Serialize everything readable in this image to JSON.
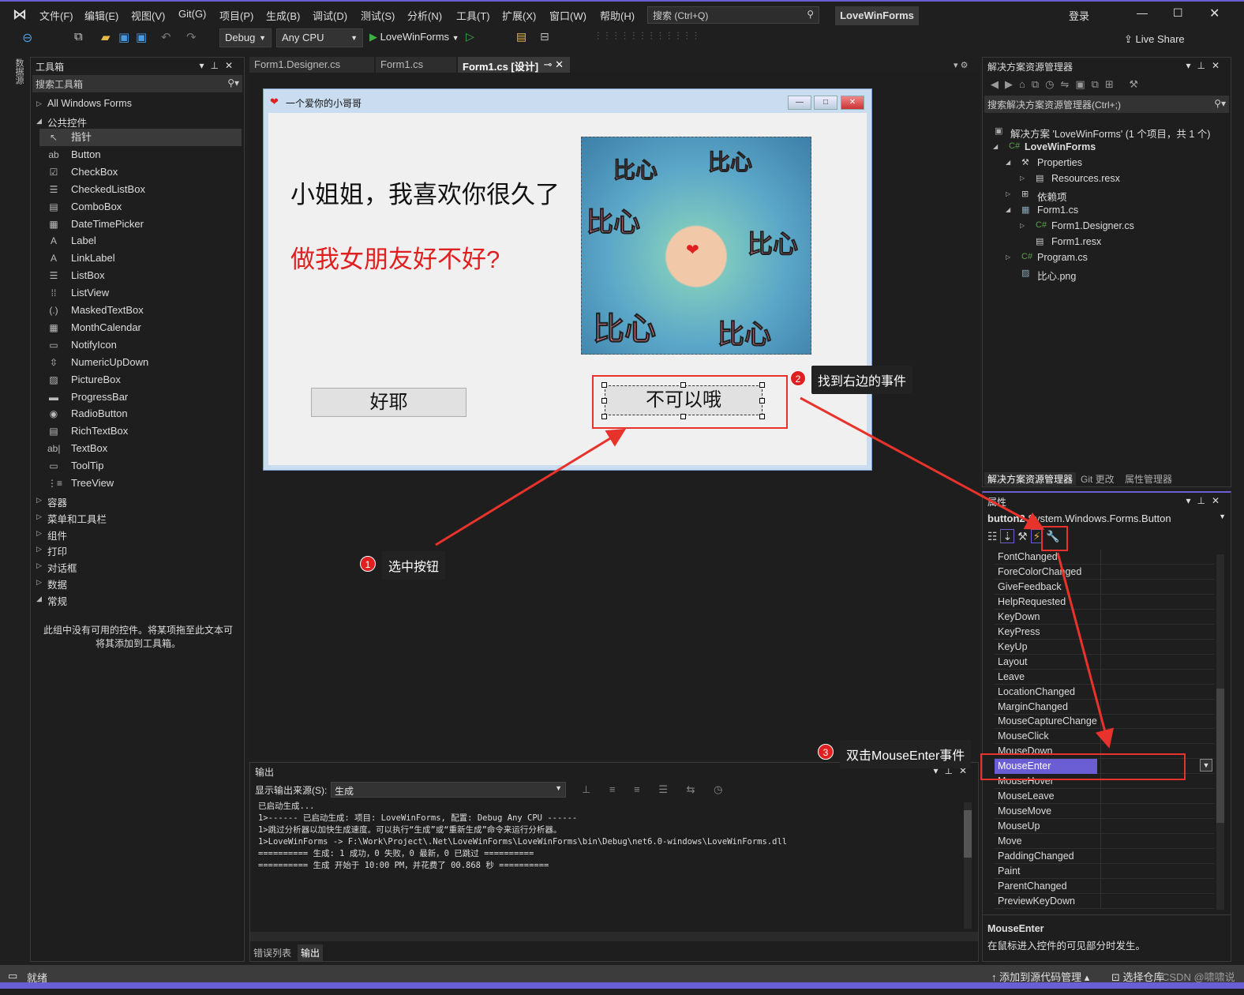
{
  "menu": [
    "文件(F)",
    "编辑(E)",
    "视图(V)",
    "Git(G)",
    "项目(P)",
    "生成(B)",
    "调试(D)",
    "测试(S)",
    "分析(N)",
    "工具(T)",
    "扩展(X)",
    "窗口(W)",
    "帮助(H)"
  ],
  "search_placeholder": "搜索 (Ctrl+Q)",
  "project_name": "LoveWinForms",
  "login": "登录",
  "live_share": "Live Share",
  "toolbar": {
    "config": "Debug",
    "platform": "Any CPU",
    "run_target": "LoveWinForms"
  },
  "side_strip": "数据源",
  "toolbox": {
    "title": "工具箱",
    "search_placeholder": "搜索工具箱",
    "all_forms": "All Windows Forms",
    "common": "公共控件",
    "items": [
      {
        "icon": "pointer",
        "label": "指针"
      },
      {
        "icon": "button",
        "label": "Button"
      },
      {
        "icon": "checkbox",
        "label": "CheckBox"
      },
      {
        "icon": "list",
        "label": "CheckedListBox"
      },
      {
        "icon": "combo",
        "label": "ComboBox"
      },
      {
        "icon": "calendar",
        "label": "DateTimePicker"
      },
      {
        "icon": "label",
        "label": "Label"
      },
      {
        "icon": "label",
        "label": "LinkLabel"
      },
      {
        "icon": "list",
        "label": "ListBox"
      },
      {
        "icon": "grid",
        "label": "ListView"
      },
      {
        "icon": "masked",
        "label": "MaskedTextBox"
      },
      {
        "icon": "calendar",
        "label": "MonthCalendar"
      },
      {
        "icon": "notify",
        "label": "NotifyIcon"
      },
      {
        "icon": "updown",
        "label": "NumericUpDown"
      },
      {
        "icon": "picture",
        "label": "PictureBox"
      },
      {
        "icon": "progress",
        "label": "ProgressBar"
      },
      {
        "icon": "radio",
        "label": "RadioButton"
      },
      {
        "icon": "richtext",
        "label": "RichTextBox"
      },
      {
        "icon": "textbox",
        "label": "TextBox"
      },
      {
        "icon": "tooltip",
        "label": "ToolTip"
      },
      {
        "icon": "tree",
        "label": "TreeView"
      }
    ],
    "categories": [
      "容器",
      "菜单和工具栏",
      "组件",
      "打印",
      "对话框",
      "数据",
      "常规"
    ],
    "empty_text": "此组中没有可用的控件。将某项拖至此文本可将其添加到工具箱。"
  },
  "tabs": [
    {
      "label": "Form1.Designer.cs"
    },
    {
      "label": "Form1.cs"
    },
    {
      "label": "Form1.cs [设计]",
      "active": true
    }
  ],
  "form": {
    "title": "一个爱你的小哥哥",
    "line1": "小姐姐，我喜欢你很久了",
    "line2": "做我女朋友好不好?",
    "picture_text": "比心",
    "button_yes": "好耶",
    "button_no": "不可以哦"
  },
  "annotations": [
    {
      "num": "1",
      "text": "选中按钮"
    },
    {
      "num": "2",
      "text": "找到右边的事件"
    },
    {
      "num": "3",
      "text": "双击MouseEnter事件"
    }
  ],
  "output": {
    "title": "输出",
    "source_label": "显示输出来源(S):",
    "source_value": "生成",
    "lines": [
      "已启动生成...",
      "1>------ 已启动生成: 项目: LoveWinForms, 配置: Debug Any CPU ------",
      "1>跳过分析器以加快生成速度。可以执行“生成”或“重新生成”命令来运行分析器。",
      "1>LoveWinForms -> F:\\Work\\Project\\.Net\\LoveWinForms\\LoveWinForms\\bin\\Debug\\net6.0-windows\\LoveWinForms.dll",
      "========== 生成: 1 成功，0 失败，0 最新，0 已跳过 ==========",
      "========== 生成 开始于 10:00 PM，并花费了 00.868 秒 =========="
    ],
    "bottom_tabs": [
      "错误列表",
      "输出"
    ]
  },
  "solution": {
    "title": "解决方案资源管理器",
    "search_placeholder": "搜索解决方案资源管理器(Ctrl+;)",
    "nodes": [
      {
        "label": "解决方案 'LoveWinForms' (1 个项目，共 1 个)"
      },
      {
        "label": "LoveWinForms"
      },
      {
        "label": "Properties"
      },
      {
        "label": "Resources.resx"
      },
      {
        "label": "依赖项"
      },
      {
        "label": "Form1.cs"
      },
      {
        "label": "Form1.Designer.cs"
      },
      {
        "label": "Form1.resx"
      },
      {
        "label": "Program.cs"
      },
      {
        "label": "比心.png"
      }
    ],
    "bottom_tabs": [
      "解决方案资源管理器",
      "Git 更改",
      "属性管理器"
    ]
  },
  "properties": {
    "title": "属性",
    "object": "button2",
    "object_type": "System.Windows.Forms.Button",
    "events": [
      "FontChanged",
      "ForeColorChanged",
      "GiveFeedback",
      "HelpRequested",
      "KeyDown",
      "KeyPress",
      "KeyUp",
      "Layout",
      "Leave",
      "LocationChanged",
      "MarginChanged",
      "MouseCaptureChanged",
      "MouseClick",
      "MouseDown",
      "MouseEnter",
      "MouseHover",
      "MouseLeave",
      "MouseMove",
      "MouseUp",
      "Move",
      "PaddingChanged",
      "Paint",
      "ParentChanged",
      "PreviewKeyDown"
    ],
    "selected": "MouseEnter",
    "desc_title": "MouseEnter",
    "desc_text": "在鼠标进入控件的可见部分时发生。"
  },
  "status": {
    "ready": "就绪",
    "source_control": "添加到源代码管理",
    "repo": "选择仓库",
    "watermark": "CSDN @啸啸说"
  },
  "colors": {
    "accent": "#6b5dd3",
    "annotation_red": "#e8332c",
    "selection": "#6b5dd3"
  }
}
